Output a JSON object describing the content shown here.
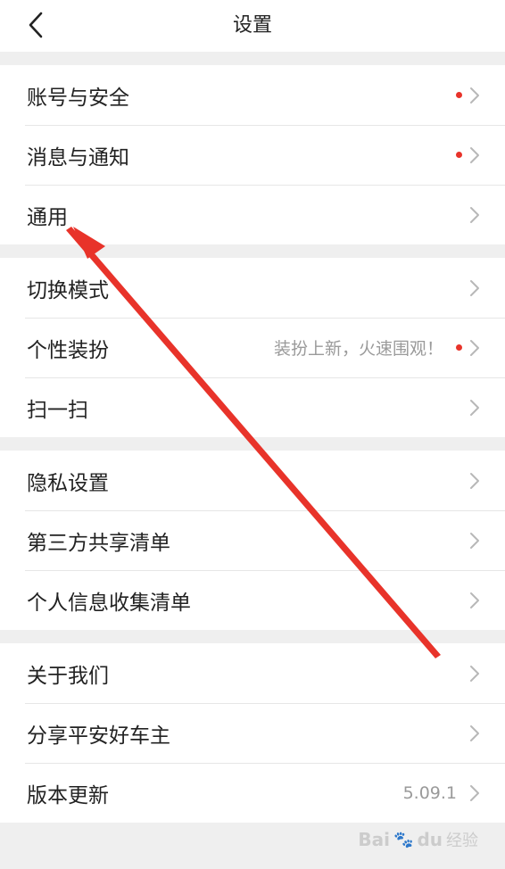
{
  "header": {
    "title": "设置",
    "back_icon": "back-chevron-icon"
  },
  "groups": [
    {
      "items": [
        {
          "label": "账号与安全",
          "sub": "",
          "dot": true
        },
        {
          "label": "消息与通知",
          "sub": "",
          "dot": true
        },
        {
          "label": "通用",
          "sub": "",
          "dot": false
        }
      ]
    },
    {
      "items": [
        {
          "label": "切换模式",
          "sub": "",
          "dot": false
        },
        {
          "label": "个性装扮",
          "sub": "装扮上新，火速围观！",
          "dot": true
        },
        {
          "label": "扫一扫",
          "sub": "",
          "dot": false
        }
      ]
    },
    {
      "items": [
        {
          "label": "隐私设置",
          "sub": "",
          "dot": false
        },
        {
          "label": "第三方共享清单",
          "sub": "",
          "dot": false
        },
        {
          "label": "个人信息收集清单",
          "sub": "",
          "dot": false
        }
      ]
    },
    {
      "items": [
        {
          "label": "关于我们",
          "sub": "",
          "dot": false
        },
        {
          "label": "分享平安好车主",
          "sub": "",
          "dot": false
        },
        {
          "label": "版本更新",
          "sub": "5.09.1",
          "dot": false
        }
      ]
    }
  ],
  "watermark": {
    "brand": "Bai",
    "brand_end": "du",
    "suffix": "经验"
  },
  "colors": {
    "accent_dot": "#e8332a",
    "annotation_arrow": "#e8332a",
    "background": "#efefef"
  }
}
